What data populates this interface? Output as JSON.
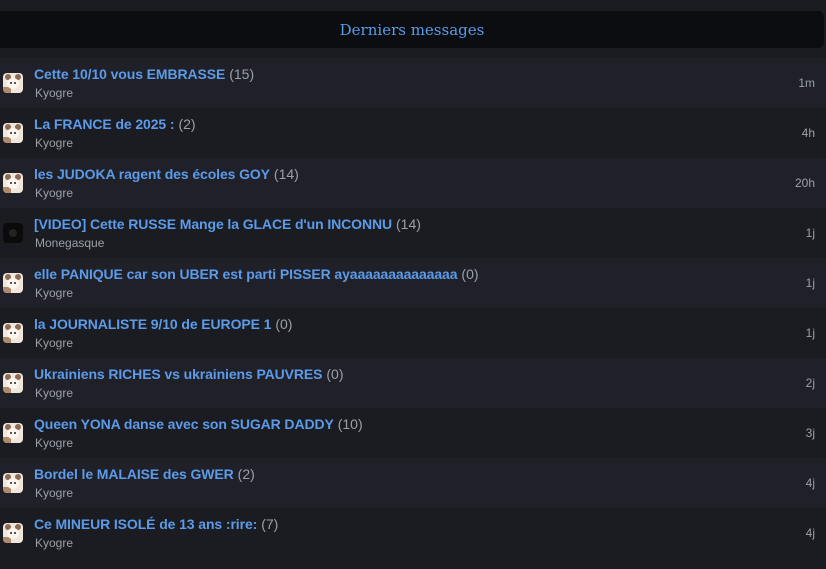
{
  "header": {
    "title": "Derniers messages"
  },
  "topics": [
    {
      "title": "Cette 10/10 vous EMBRASSE",
      "count": "(15)",
      "author": "Kyogre",
      "time": "1m",
      "avatar": "hamster-avatar"
    },
    {
      "title": "La FRANCE de 2025 :",
      "count": "(2)",
      "author": "Kyogre",
      "time": "4h",
      "avatar": "hamster-avatar"
    },
    {
      "title": "les JUDOKA ragent des écoles GOY",
      "count": "(14)",
      "author": "Kyogre",
      "time": "20h",
      "avatar": "hamster-avatar"
    },
    {
      "title": "[VIDEO] Cette RUSSE Mange la GLACE d'un INCONNU",
      "count": "(14)",
      "author": "Monegasque",
      "time": "1j",
      "avatar": "dark-avatar"
    },
    {
      "title": "elle PANIQUE car son UBER est parti PISSER ayaaaaaaaaaaaaaa",
      "count": "(0)",
      "author": "Kyogre",
      "time": "1j",
      "avatar": "hamster-avatar"
    },
    {
      "title": "la JOURNALISTE 9/10 de EUROPE 1",
      "count": "(0)",
      "author": "Kyogre",
      "time": "1j",
      "avatar": "hamster-avatar"
    },
    {
      "title": "Ukrainiens RICHES vs ukrainiens PAUVRES",
      "count": "(0)",
      "author": "Kyogre",
      "time": "2j",
      "avatar": "hamster-avatar"
    },
    {
      "title": "Queen YONA danse avec son SUGAR DADDY",
      "count": "(10)",
      "author": "Kyogre",
      "time": "3j",
      "avatar": "hamster-avatar"
    },
    {
      "title": "Bordel le MALAISE des GWER",
      "count": "(2)",
      "author": "Kyogre",
      "time": "4j",
      "avatar": "hamster-avatar"
    },
    {
      "title": "Ce MINEUR ISOLÉ de 13 ans :rire:",
      "count": "(7)",
      "author": "Kyogre",
      "time": "4j",
      "avatar": "hamster-avatar"
    }
  ],
  "colors": {
    "link": "#5b9bea",
    "muted": "#9aa0aa",
    "background": "#1b1c21",
    "row_alt": "#202128",
    "header_bg": "#0c0d10"
  }
}
